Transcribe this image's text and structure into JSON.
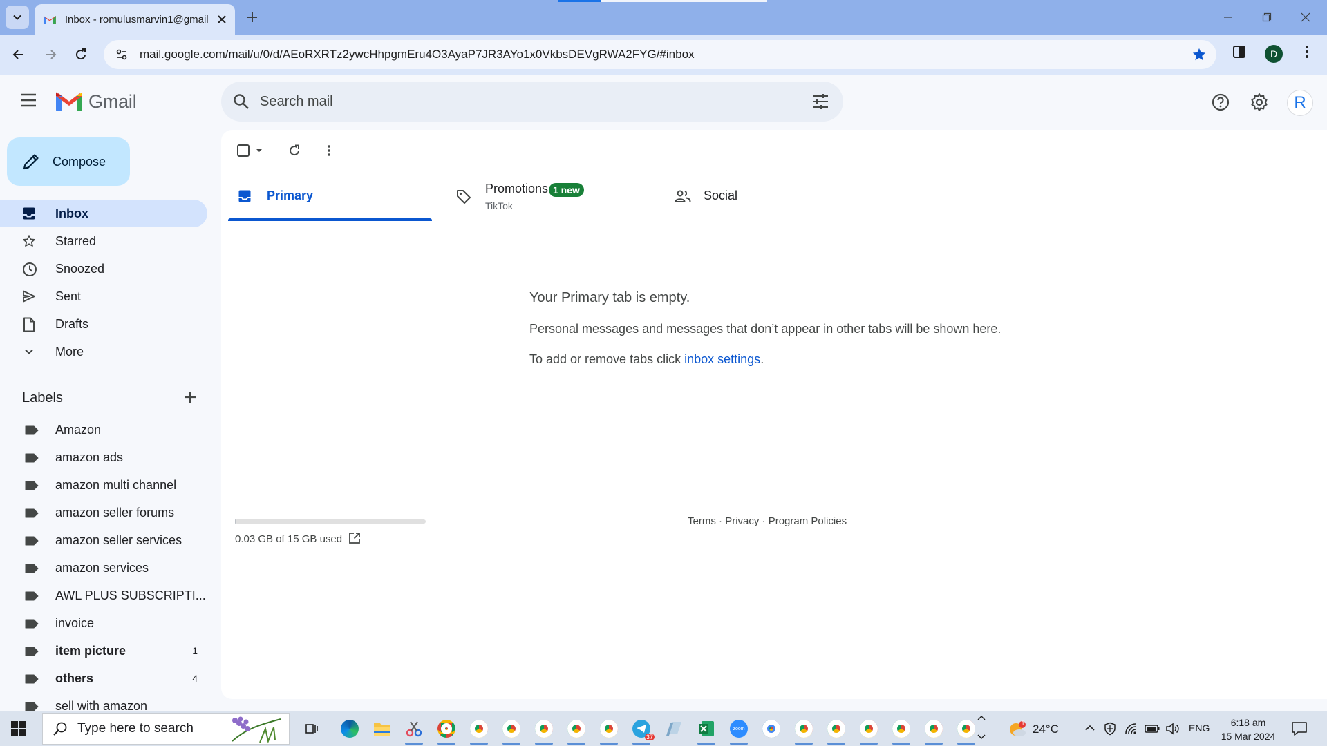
{
  "browser": {
    "tab_title": "Inbox - romulusmarvin1@gmail",
    "url": "mail.google.com/mail/u/0/d/AEoRXRTz2ywcHhpgmEru4O3AyaP7JR3AYo1x0VkbsDEVgRWA2FYG/#inbox",
    "profile_initial": "D"
  },
  "gmail": {
    "wordmark": "Gmail",
    "search_placeholder": "Search mail",
    "account_initial": "R",
    "compose_label": "Compose",
    "nav": [
      {
        "label": "Inbox",
        "icon": "inbox-icon",
        "active": true
      },
      {
        "label": "Starred",
        "icon": "star-icon"
      },
      {
        "label": "Snoozed",
        "icon": "clock-icon"
      },
      {
        "label": "Sent",
        "icon": "send-icon"
      },
      {
        "label": "Drafts",
        "icon": "draft-icon"
      },
      {
        "label": "More",
        "icon": "chevron-down-icon"
      }
    ],
    "labels_heading": "Labels",
    "labels": [
      {
        "name": "Amazon"
      },
      {
        "name": "amazon ads"
      },
      {
        "name": "amazon multi channel"
      },
      {
        "name": "amazon seller forums"
      },
      {
        "name": "amazon seller services"
      },
      {
        "name": "amazon services"
      },
      {
        "name": "AWL PLUS SUBSCRIPTI..."
      },
      {
        "name": "invoice"
      },
      {
        "name": "item picture",
        "count": "1",
        "bold": true
      },
      {
        "name": "others",
        "count": "4",
        "bold": true
      },
      {
        "name": "sell with amazon"
      }
    ],
    "tabs": {
      "primary": "Primary",
      "promotions": "Promotions",
      "promotions_badge": "1 new",
      "promotions_sub": "TikTok",
      "social": "Social"
    },
    "empty_state": {
      "title": "Your Primary tab is empty.",
      "description": "Personal messages and messages that don’t appear in other tabs will be shown here.",
      "hint_prefix": "To add or remove tabs click ",
      "hint_link": "inbox settings",
      "hint_suffix": "."
    },
    "storage": {
      "text": "0.03 GB of 15 GB used",
      "used_fraction": 0.002
    },
    "footer": {
      "terms": "Terms",
      "privacy": "Privacy",
      "policies": "Program Policies",
      "separator": "·"
    }
  },
  "taskbar": {
    "search_placeholder": "Type here to search",
    "weather_temp": "24°C",
    "weather_badge": "1",
    "language": "ENG",
    "time": "6:18 am",
    "date": "15 Mar 2024",
    "telegram_badge": "37"
  },
  "colors": {
    "accent": "#0b57d0",
    "compose_bg": "#c2e7ff",
    "active_nav": "#d3e3fd",
    "badge_green": "#188038"
  }
}
